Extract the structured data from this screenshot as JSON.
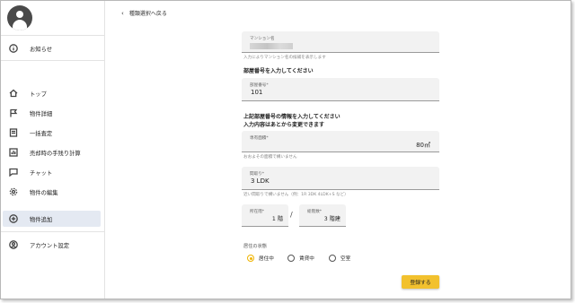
{
  "sidebar": {
    "items": [
      {
        "label": "お知らせ",
        "icon": "info-icon"
      },
      {
        "label": "トップ",
        "icon": "home-icon"
      },
      {
        "label": "物件詳細",
        "icon": "flag-icon"
      },
      {
        "label": "一括査定",
        "icon": "document-icon"
      },
      {
        "label": "売却時の手残り計算",
        "icon": "chart-icon"
      },
      {
        "label": "チャット",
        "icon": "chat-icon"
      },
      {
        "label": "物件の編集",
        "icon": "gear-icon"
      },
      {
        "label": "物件追加",
        "icon": "plus-circle-icon"
      },
      {
        "label": "アカウント設定",
        "icon": "account-icon"
      }
    ]
  },
  "header": {
    "back_label": "種類選択へ戻る"
  },
  "form": {
    "mansion": {
      "label": "マンション名",
      "helper": "入力によりマンション名の候補を表示します"
    },
    "room_heading": "部屋番号を入力してください",
    "room": {
      "label": "部屋番号*",
      "value": "101"
    },
    "info_heading_1": "上記部屋番号の情報を入力してください",
    "info_heading_2": "入力内容はあとから変更できます",
    "area": {
      "label": "専有面積*",
      "value": "80",
      "unit": "㎡",
      "helper": "おおよその面積で構いません"
    },
    "layout": {
      "label": "間取り*",
      "value": "3 LDK",
      "helper": "近い間取りで構いません（例：1R 3DK 4LDK+S など）"
    },
    "floor": {
      "label": "所在階*",
      "value": "1",
      "unit": "階"
    },
    "total_floors": {
      "label": "総階数*",
      "value": "3",
      "unit": "階建"
    },
    "status_label": "居住の状態",
    "status_options": [
      "居住中",
      "賃貸中",
      "空室"
    ],
    "status_selected": "居住中",
    "submit_label": "登録する"
  },
  "colors": {
    "accent": "#f2c12e",
    "active_nav": "#e4e9f2"
  }
}
